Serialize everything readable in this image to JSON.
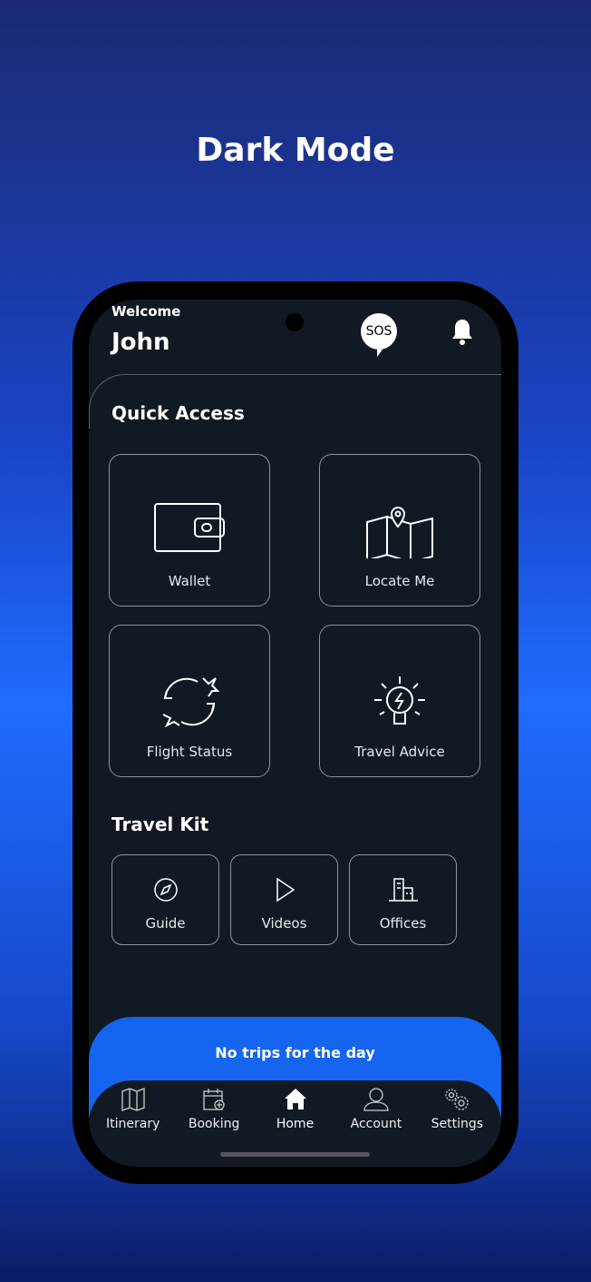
{
  "page_title": "Dark Mode",
  "header": {
    "welcome": "Welcome",
    "name": "John",
    "sos": "SOS"
  },
  "quick_access": {
    "title": "Quick Access",
    "items": [
      {
        "label": "Wallet",
        "icon": "wallet-icon"
      },
      {
        "label": "Locate Me",
        "icon": "map-pin-icon"
      },
      {
        "label": "Flight Status",
        "icon": "flight-status-icon"
      },
      {
        "label": "Travel Advice",
        "icon": "lightbulb-icon"
      }
    ]
  },
  "travel_kit": {
    "title": "Travel Kit",
    "items": [
      {
        "label": "Guide",
        "icon": "compass-icon"
      },
      {
        "label": "Videos",
        "icon": "play-icon"
      },
      {
        "label": "Offices",
        "icon": "building-icon"
      }
    ]
  },
  "banner": "No trips for the day",
  "nav": [
    {
      "label": "Itinerary"
    },
    {
      "label": "Booking"
    },
    {
      "label": "Home",
      "active": true
    },
    {
      "label": "Account"
    },
    {
      "label": "Settings"
    }
  ],
  "colors": {
    "accent": "#1565f0",
    "screen_bg": "#111a22"
  }
}
